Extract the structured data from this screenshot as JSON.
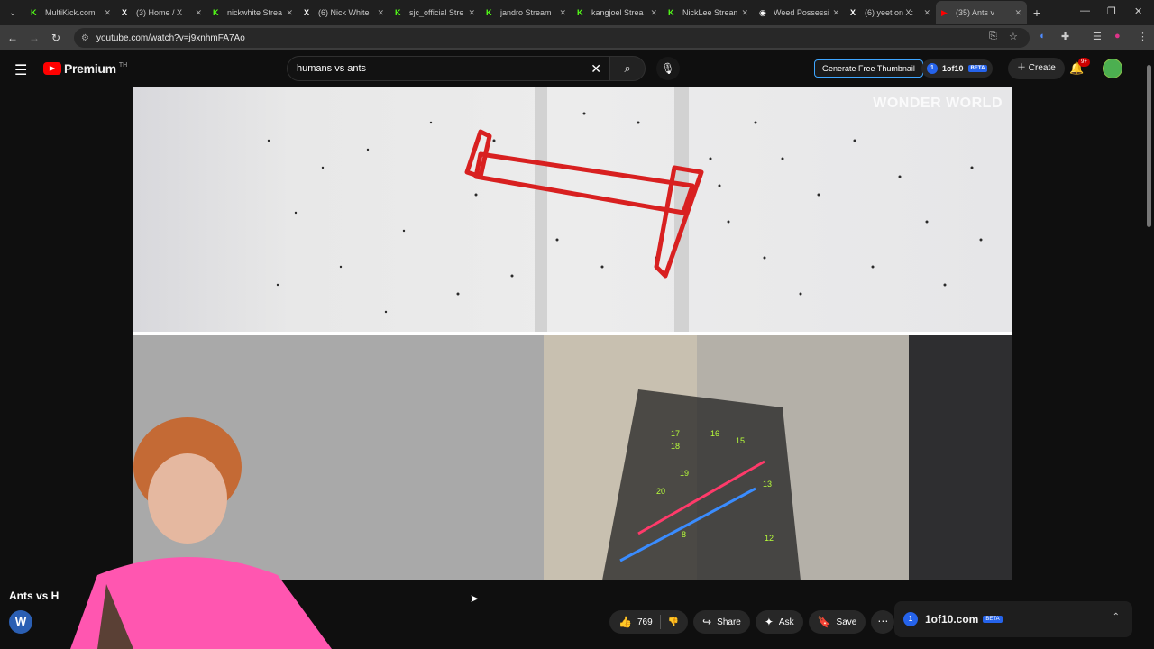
{
  "browser": {
    "tabs": [
      {
        "label": "MultiKick.com",
        "favicon": "K",
        "color": "#53fc18"
      },
      {
        "label": "(3) Home / X",
        "favicon": "X",
        "color": "#ffffff"
      },
      {
        "label": "nickwhite Strea",
        "favicon": "K",
        "color": "#53fc18"
      },
      {
        "label": "(6) Nick White",
        "favicon": "X",
        "color": "#ffffff"
      },
      {
        "label": "sjc_official Stre",
        "favicon": "K",
        "color": "#53fc18"
      },
      {
        "label": "jandro Stream",
        "favicon": "K",
        "color": "#53fc18"
      },
      {
        "label": "kangjoel Strea",
        "favicon": "K",
        "color": "#53fc18"
      },
      {
        "label": "NickLee Stream",
        "favicon": "K",
        "color": "#53fc18"
      },
      {
        "label": "Weed Possessi",
        "favicon": "◉",
        "color": "#ffffff"
      },
      {
        "label": "(6) yeet on X:",
        "favicon": "X",
        "color": "#ffffff"
      },
      {
        "label": "(35) Ants v",
        "favicon": "▶",
        "color": "#ff0000"
      }
    ],
    "url": "youtube.com/watch?v=j9xnhmFA7Ao"
  },
  "youtube": {
    "brand": "Premium",
    "region": "TH",
    "search_query": "humans vs ants",
    "generate_thumbnail": "Generate Free Thumbnail",
    "oneof10": "1of10",
    "beta": "BETA",
    "create": "Create",
    "notif_count": "9+"
  },
  "video": {
    "watermark": "WONDER WORLD",
    "title": "Ants vs H",
    "channel_initial": "W",
    "likes": "769",
    "share": "Share",
    "ask": "Ask",
    "save": "Save"
  },
  "side_panel": {
    "name": "1of10.com",
    "beta": "BETA",
    "dot_label": "1"
  }
}
